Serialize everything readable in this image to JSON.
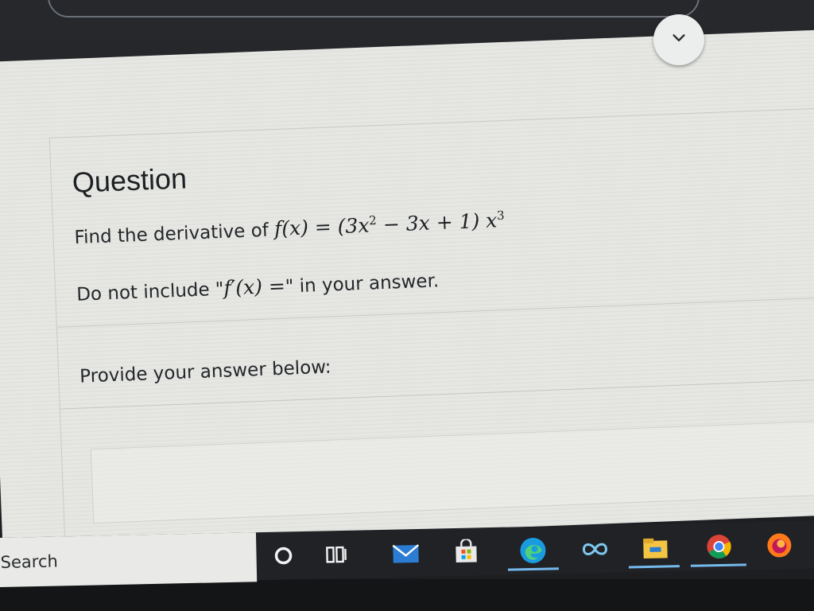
{
  "question": {
    "title": "Question",
    "prompt_prefix": "Find the derivative of ",
    "function_lhs": "f(x)",
    "equals": " = ",
    "open_paren": "(3x",
    "exp_2": "2",
    "mid_terms": " − 3x + 1",
    "close_paren": ") x",
    "exp_3": "3",
    "instruction_prefix": "Do not include \"",
    "instruction_math": "f′(x) =",
    "instruction_suffix": "\" in your answer.",
    "answer_prompt": "Provide your answer below:"
  },
  "answer_input": {
    "value": "",
    "placeholder": ""
  },
  "taskbar": {
    "search_label": "Search",
    "icons": [
      "cortana-circle-icon",
      "task-view-icon",
      "mail-icon",
      "store-icon",
      "edge-icon",
      "infinity-app-icon",
      "file-explorer-icon",
      "chrome-icon",
      "firefox-icon"
    ]
  },
  "colors": {
    "page_bg": "#e6e7e3",
    "text": "#24262a",
    "taskbar": "#202226",
    "active_underline": "#76b9ed"
  }
}
